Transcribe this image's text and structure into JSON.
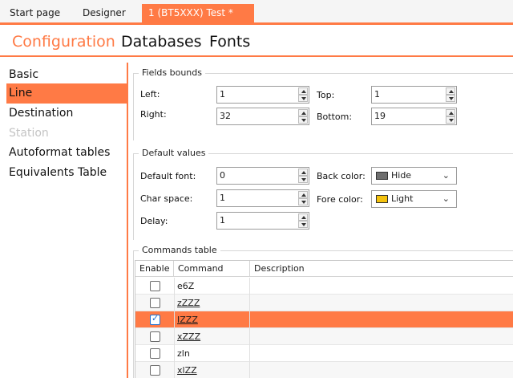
{
  "doc_tabs": {
    "start_page": "Start page",
    "designer": "Designer",
    "active": "1 (BT5XXX) Test *",
    "close_glyph": "✕"
  },
  "section_tabs": {
    "configuration": "Configuration",
    "databases": "Databases",
    "fonts": "Fonts"
  },
  "nav": {
    "items": [
      {
        "label": "Basic",
        "state": "normal"
      },
      {
        "label": "Line",
        "state": "selected"
      },
      {
        "label": "Destination",
        "state": "normal"
      },
      {
        "label": "Station",
        "state": "disabled"
      },
      {
        "label": "Autoformat tables",
        "state": "normal"
      },
      {
        "label": "Equivalents Table",
        "state": "normal"
      }
    ]
  },
  "fields_bounds": {
    "title": "Fields bounds",
    "left_label": "Left:",
    "left_value": "1",
    "top_label": "Top:",
    "top_value": "1",
    "right_label": "Right:",
    "right_value": "32",
    "bottom_label": "Bottom:",
    "bottom_value": "19"
  },
  "default_values": {
    "title": "Default values",
    "font_label": "Default font:",
    "font_value": "0",
    "charspace_label": "Char space:",
    "charspace_value": "1",
    "delay_label": "Delay:",
    "delay_value": "1",
    "backcolor_label": "Back color:",
    "backcolor_value": "Hide",
    "backcolor_swatch": "#6e6e6e",
    "forecolor_label": "Fore color:",
    "forecolor_value": "Light",
    "forecolor_swatch": "#f4c20d"
  },
  "commands_table": {
    "title": "Commands table",
    "headers": {
      "enable": "Enable",
      "command": "Command",
      "description": "Description"
    },
    "rows": [
      {
        "enabled": false,
        "command": "e6Z",
        "description": ""
      },
      {
        "enabled": false,
        "command": "zZZZ",
        "description": ""
      },
      {
        "enabled": true,
        "command": "IZZZ",
        "description": ""
      },
      {
        "enabled": false,
        "command": "xZZZ",
        "description": ""
      },
      {
        "enabled": false,
        "command": "zln",
        "description": ""
      },
      {
        "enabled": false,
        "command": "xlZZ",
        "description": ""
      }
    ]
  },
  "colors": {
    "accent": "#ff7a45",
    "checkbox_check": "#1e6fd0"
  }
}
